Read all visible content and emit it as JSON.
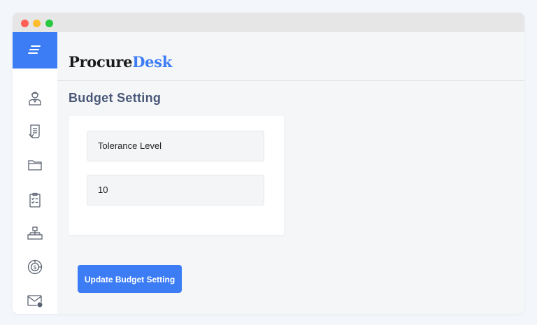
{
  "window": {
    "controls": [
      "close",
      "minimize",
      "maximize"
    ]
  },
  "sidebar": {
    "menu_icon": "menu-lines-icon",
    "items": [
      {
        "icon": "user-icon"
      },
      {
        "icon": "document-list-icon"
      },
      {
        "icon": "folder-icon"
      },
      {
        "icon": "clipboard-checklist-icon"
      },
      {
        "icon": "hierarchy-org-icon"
      },
      {
        "icon": "budget-pie-dollar-icon"
      },
      {
        "icon": "mail-notification-icon"
      }
    ]
  },
  "header": {
    "logo_part1": "Procure",
    "logo_part2": "Desk"
  },
  "page": {
    "title": "Budget Setting"
  },
  "form": {
    "tolerance_label": "Tolerance Level",
    "tolerance_value": "10"
  },
  "actions": {
    "update_label": "Update Budget Setting"
  },
  "colors": {
    "accent": "#3c7cf5",
    "title": "#4a5878",
    "icon": "#5a6270"
  }
}
